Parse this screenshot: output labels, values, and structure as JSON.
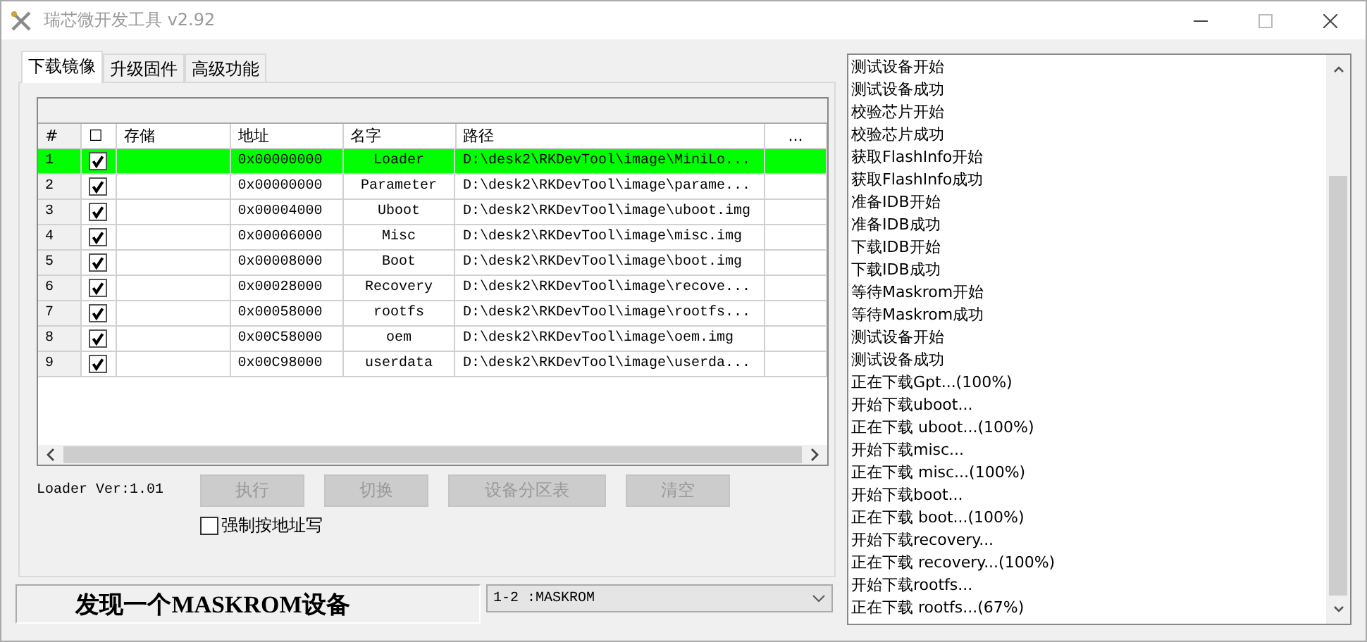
{
  "window": {
    "title": "瑞芯微开发工具 v2.92"
  },
  "tabs": [
    {
      "label": "下载镜像",
      "selected": true
    },
    {
      "label": "升级固件",
      "selected": false
    },
    {
      "label": "高级功能",
      "selected": false
    }
  ],
  "table": {
    "columns": [
      "#",
      "☐",
      "存储",
      "地址",
      "名字",
      "路径",
      "..."
    ],
    "rows": [
      {
        "index": "1",
        "checked": true,
        "selected": true,
        "storage": "",
        "address": "0x00000000",
        "name": "Loader",
        "path": "D:\\desk2\\RKDevTool\\image\\MiniLo..."
      },
      {
        "index": "2",
        "checked": true,
        "selected": false,
        "storage": "",
        "address": "0x00000000",
        "name": "Parameter",
        "path": "D:\\desk2\\RKDevTool\\image\\parame..."
      },
      {
        "index": "3",
        "checked": true,
        "selected": false,
        "storage": "",
        "address": "0x00004000",
        "name": "Uboot",
        "path": "D:\\desk2\\RKDevTool\\image\\uboot.img"
      },
      {
        "index": "4",
        "checked": true,
        "selected": false,
        "storage": "",
        "address": "0x00006000",
        "name": "Misc",
        "path": "D:\\desk2\\RKDevTool\\image\\misc.img"
      },
      {
        "index": "5",
        "checked": true,
        "selected": false,
        "storage": "",
        "address": "0x00008000",
        "name": "Boot",
        "path": "D:\\desk2\\RKDevTool\\image\\boot.img"
      },
      {
        "index": "6",
        "checked": true,
        "selected": false,
        "storage": "",
        "address": "0x00028000",
        "name": "Recovery",
        "path": "D:\\desk2\\RKDevTool\\image\\recove..."
      },
      {
        "index": "7",
        "checked": true,
        "selected": false,
        "storage": "",
        "address": "0x00058000",
        "name": "rootfs",
        "path": "D:\\desk2\\RKDevTool\\image\\rootfs..."
      },
      {
        "index": "8",
        "checked": true,
        "selected": false,
        "storage": "",
        "address": "0x00C58000",
        "name": "oem",
        "path": "D:\\desk2\\RKDevTool\\image\\oem.img"
      },
      {
        "index": "9",
        "checked": true,
        "selected": false,
        "storage": "",
        "address": "0x00C98000",
        "name": "userdata",
        "path": "D:\\desk2\\RKDevTool\\image\\userda..."
      }
    ]
  },
  "loader_version": "Loader Ver:1.01",
  "buttons": [
    {
      "label": "执行",
      "disabled": true
    },
    {
      "label": "切换",
      "disabled": true
    },
    {
      "label": "设备分区表",
      "disabled": true
    },
    {
      "label": "清空",
      "disabled": true
    }
  ],
  "force_address_write": {
    "label": "强制按地址写",
    "checked": false
  },
  "status": "发现一个MASKROM设备",
  "device_select": {
    "value": "1-2 :MASKROM"
  },
  "log": [
    "测试设备开始",
    "测试设备成功",
    "校验芯片开始",
    "校验芯片成功",
    "获取FlashInfo开始",
    "获取FlashInfo成功",
    "准备IDB开始",
    "准备IDB成功",
    "下载IDB开始",
    "下载IDB成功",
    "等待Maskrom开始",
    "等待Maskrom成功",
    "测试设备开始",
    "测试设备成功",
    "正在下载Gpt...(100%)",
    "开始下载uboot...",
    "正在下载 uboot...(100%)",
    "开始下载misc...",
    "正在下载 misc...(100%)",
    "开始下载boot...",
    "正在下载 boot...(100%)",
    "开始下载recovery...",
    "正在下载 recovery...(100%)",
    "开始下载rootfs...",
    "正在下载 rootfs...(67%)"
  ]
}
